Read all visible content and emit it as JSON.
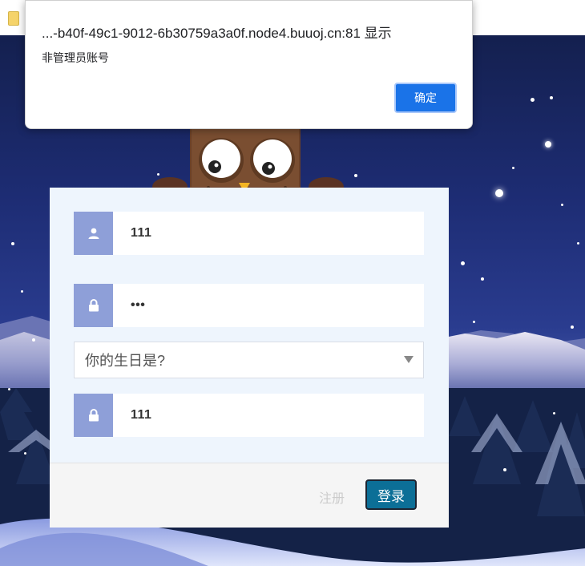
{
  "dialog": {
    "title": "...-b40f-49c1-9012-6b30759a3a0f.node4.buuoj.cn:81 显示",
    "message": "非管理员账号",
    "ok_label": "确定"
  },
  "form": {
    "username_value": "111",
    "password_value": "•••",
    "question_selected": "你的生日是?",
    "answer_value": "111",
    "register_label": "注册",
    "login_label": "登录"
  },
  "icons": {
    "favicon": "folder-icon",
    "user": "user-icon",
    "lock": "lock-icon",
    "caret": "chevron-down-icon"
  },
  "colors": {
    "icon_box": "#8e9fd8",
    "panel_bg": "#eef5fd",
    "login_button": "#0c6f97",
    "dialog_ok": "#1a73e8"
  }
}
